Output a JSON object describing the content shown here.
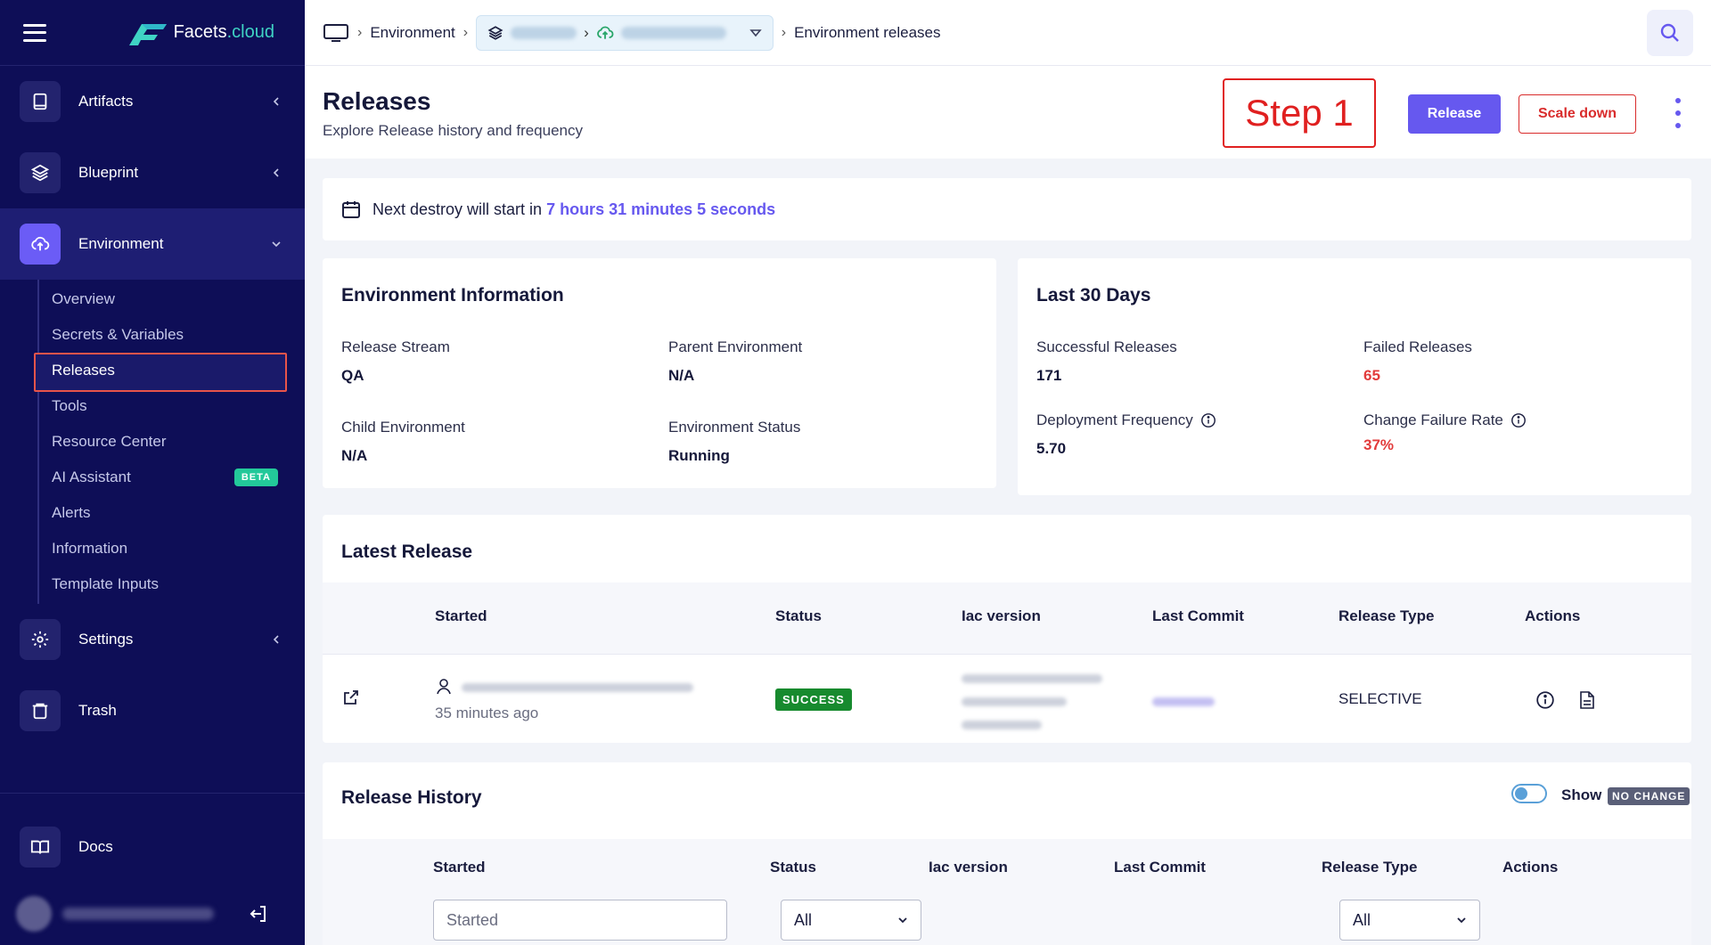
{
  "brand": {
    "name_part1": "Facets",
    "name_part2": ".cloud"
  },
  "sidebar": {
    "items": [
      {
        "label": "Artifacts"
      },
      {
        "label": "Blueprint"
      },
      {
        "label": "Environment"
      },
      {
        "label": "Settings"
      },
      {
        "label": "Trash"
      },
      {
        "label": "Docs"
      }
    ],
    "env_sub": [
      "Overview",
      "Secrets & Variables",
      "Releases",
      "Tools",
      "Resource Center",
      "AI Assistant",
      "Alerts",
      "Information",
      "Template Inputs"
    ],
    "beta_label": "BETA"
  },
  "breadcrumb": {
    "env": "Environment",
    "current": "Environment releases"
  },
  "page": {
    "title": "Releases",
    "subtitle": "Explore Release history and frequency",
    "step": "Step 1",
    "release_btn": "Release",
    "scale_btn": "Scale down"
  },
  "destroy": {
    "prefix": "Next destroy will start in",
    "time": "7 hours 31 minutes 5 seconds"
  },
  "env_info": {
    "title": "Environment Information",
    "release_stream_label": "Release Stream",
    "release_stream": "QA",
    "parent_label": "Parent Environment",
    "parent": "N/A",
    "child_label": "Child Environment",
    "child": "N/A",
    "status_label": "Environment Status",
    "status": "Running"
  },
  "last30": {
    "title": "Last 30 Days",
    "success_label": "Successful Releases",
    "success": "171",
    "failed_label": "Failed Releases",
    "failed": "65",
    "freq_label": "Deployment Frequency",
    "freq": "5.70",
    "cfr_label": "Change Failure Rate",
    "cfr": "37%"
  },
  "latest": {
    "title": "Latest Release",
    "headers": [
      "Started",
      "Status",
      "Iac version",
      "Last Commit",
      "Release Type",
      "Actions"
    ],
    "row": {
      "started_ago": "35 minutes ago",
      "status": "SUCCESS",
      "release_type": "SELECTIVE"
    }
  },
  "history": {
    "title": "Release History",
    "show_label": "Show",
    "badge": "NO CHANGE",
    "headers": [
      "Started",
      "Status",
      "Iac version",
      "Last Commit",
      "Release Type",
      "Actions"
    ],
    "started_placeholder": "Started",
    "status_value": "All",
    "type_value": "All"
  },
  "colors": {
    "sidebar": "#0e0e57",
    "accent": "#6658ef",
    "danger": "#d92b2b",
    "success": "#178a2e"
  }
}
